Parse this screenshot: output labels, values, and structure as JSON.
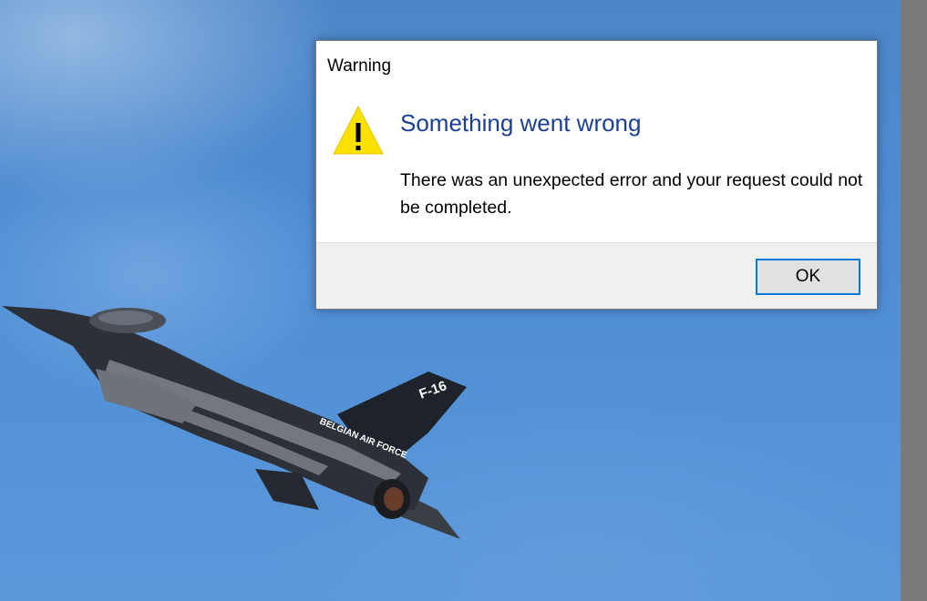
{
  "dialog": {
    "title": "Warning",
    "icon": "warning-icon",
    "main_instruction": "Something went wrong",
    "content": "There was an unexpected error and your request could not be completed.",
    "ok_label": "OK"
  },
  "wallpaper": {
    "aircraft_marking": "BELGIAN AIR FORCE",
    "tail_marking": "F-16"
  },
  "colors": {
    "main_instruction": "#1c3f94",
    "button_focus_border": "#0078d7",
    "warning_yellow": "#fce100",
    "sky": "#4f8ed5"
  }
}
